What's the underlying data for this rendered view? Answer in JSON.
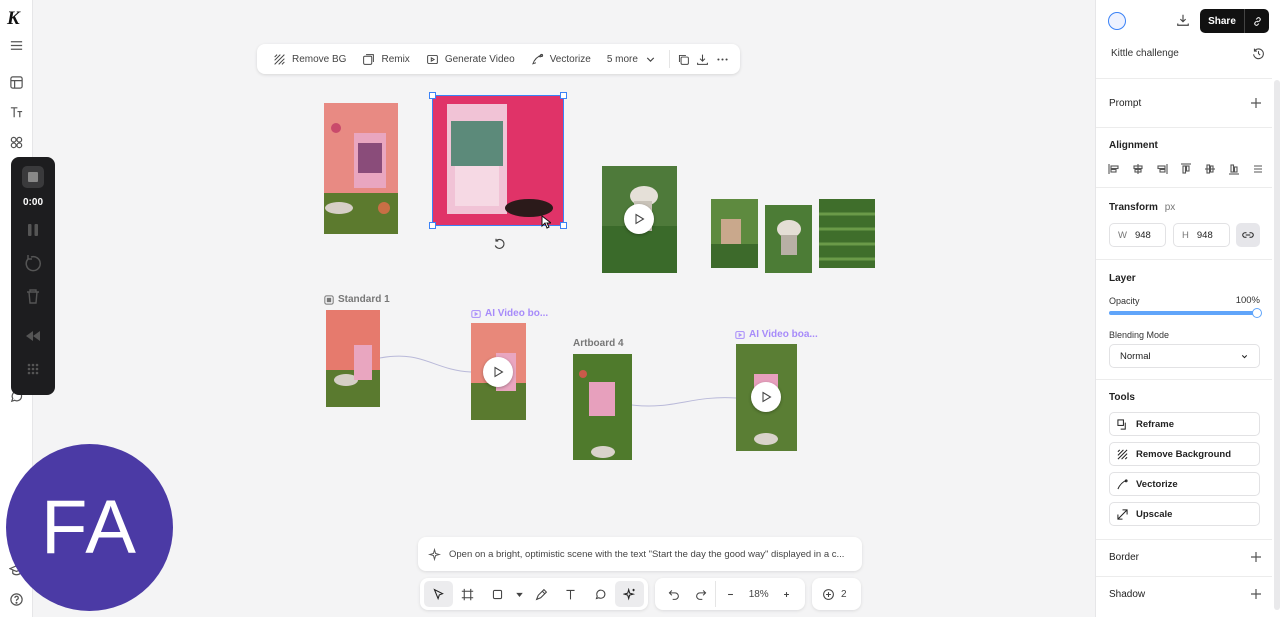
{
  "top_toolbar": {
    "remove_bg": "Remove BG",
    "remix": "Remix",
    "generate_video": "Generate Video",
    "vectorize": "Vectorize",
    "more": "5 more"
  },
  "canvas": {
    "standard_label": "Standard 1",
    "ai_video_label_1": "AI Video bo...",
    "artboard_label": "Artboard 4",
    "ai_video_label_2": "AI Video boa..."
  },
  "video_controls": {
    "time": "0:00"
  },
  "avatar": {
    "initials": "FA"
  },
  "prompt_bar": {
    "text": "Open on a bright, optimistic scene with the text \"Start the day the good way\" displayed in a c..."
  },
  "bottom_toolbar": {
    "zoom": "18%",
    "count": "2"
  },
  "right_panel": {
    "share": "Share",
    "project_name": "Kittle challenge",
    "prompt": "Prompt",
    "alignment": "Alignment",
    "transform": "Transform",
    "transform_unit": "px",
    "w_label": "W",
    "w_value": "948",
    "h_label": "H",
    "h_value": "948",
    "layer": "Layer",
    "opacity_label": "Opacity",
    "opacity_value": "100%",
    "opacity_fraction": 1.0,
    "blending_label": "Blending Mode",
    "blending_value": "Normal",
    "tools": "Tools",
    "tool_items": [
      "Reframe",
      "Remove Background",
      "Vectorize",
      "Upscale"
    ],
    "border": "Border",
    "shadow": "Shadow"
  },
  "colors": {
    "accent": "#3b82f6",
    "avatar": "#4b3aa5",
    "purple_label": "#a78bfa"
  }
}
